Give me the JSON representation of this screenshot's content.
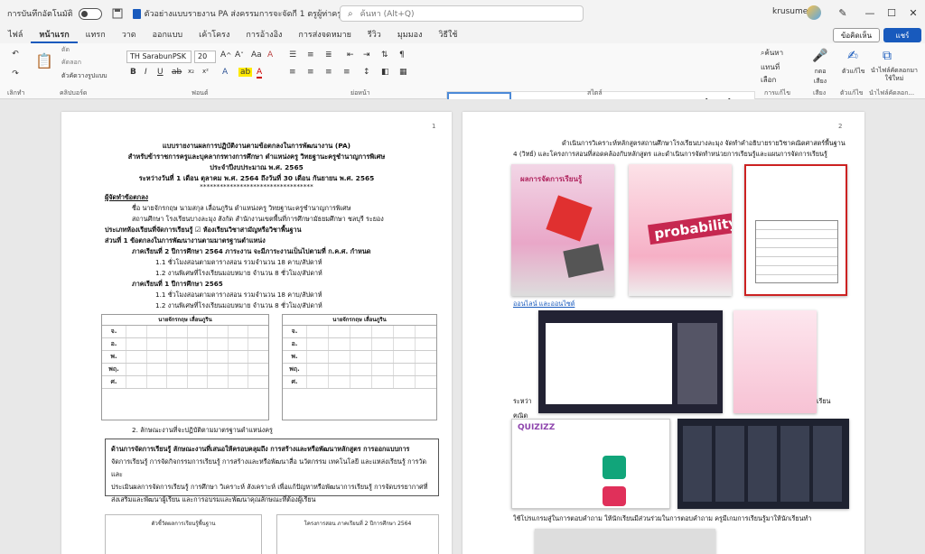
{
  "titlebar": {
    "autosave_label": "การบันทึกอัตโนมัติ",
    "doc_title": "ตัวอย่างแบบรายงาน PA ส่งครรมการจะจัดกี 1 ตรูผู้ท่าครูส.docx",
    "search_placeholder": "ค้นหา (Alt+Q)",
    "user": "krusumet2"
  },
  "menu": {
    "tabs": [
      "ไฟล์",
      "หน้าแรก",
      "แทรก",
      "วาด",
      "ออกแบบ",
      "เค้าโครง",
      "การอ้างอิง",
      "การส่งจดหมาย",
      "รีวิว",
      "มุมมอง",
      "วิธีใช้"
    ],
    "active": "หน้าแรก",
    "comments": "ข้อคิดเห็น",
    "share": "แชร์"
  },
  "ribbon": {
    "font_name": "TH SarabunPSK",
    "font_size": "20",
    "groups": [
      "เลิกทำ",
      "คลิปบอร์ด",
      "ฟอนต์",
      "ย่อหน้า",
      "สไตล์",
      "การแก้ไข",
      "เสียง",
      "ตัวแก้ไข",
      "นำไฟล์คัดลอก..."
    ],
    "clipboard": [
      "ตัด",
      "คัดลอก",
      "ตัวคัดวางรูปแบบ"
    ],
    "styles": [
      "ปกติ",
      "ไม่มีการเว้นระยะ",
      "หัวเรื่อง 1",
      "หัวเรื่อง 2",
      "ชื่อเรื่อง"
    ],
    "editing": [
      "ค้นหา",
      "แทนที่",
      "เลือก"
    ],
    "voice": "กดอ เสียง",
    "editor": "ตัวแก้ไข",
    "reuse": "นำไฟล์คัดลอกมาใช้ใหม่"
  },
  "page1": {
    "number": "1",
    "heading": [
      "แบบรายงานผลการปฏิบัติงานตามข้อตกลงในการพัฒนางาน (PA)",
      "สำหรับข้าราชการครูและบุคลากรทางการศึกษา ตำแหน่งครู วิทยฐานะครูชำนาญการพิเศษ",
      "ประจำปีงบประมาณ พ.ศ. 2565",
      "ระหว่างวันที่ 1 เดือน ตุลาคม พ.ศ. 2564 ถึงวันที่ 30 เดือน กันยายน พ.ศ. 2565",
      "**********************************"
    ],
    "lines": [
      "ผู้จัดทำข้อตกลง",
      "ชื่อ นายจักรกฤษ  นามสกุล  เลื่อนภูริน  ตำแหน่งครู วิทยฐานะครูชำนาญการพิเศษ",
      "สถานศึกษา  โรงเรียนบางละมุง  สังกัด สำนักงานเขตพื้นที่การศึกษามัธยมศึกษา ชลบุรี ระยอง",
      "ประเภทห้องเรียนที่จัดการเรียนรู้  ☑ ห้องเรียนวิชาสามัญหรือวิชาพื้นฐาน",
      "ส่วนที่ 1 ข้อตกลงในการพัฒนางานตามมาตรฐานตำแหน่ง",
      "ภาคเรียนที่ 2 ปีการศึกษา 2564  ภาระงาน จะมีภาระงานเป็นไปตามที่ ก.ค.ศ. กำหนด",
      "1.1 ชั่วโมงสอนตามตารางสอน รวมจำนวน  18  คาบ/สัปดาห์",
      "1.2 งานพิเศษที่โรงเรียนมอบหมาย จำนวน 8 ชั่วโมง/สัปดาห์",
      "ภาคเรียนที่ 1 ปีการศึกษา 2565",
      "1.1 ชั่วโมงสอนตามตารางสอน รวมจำนวน  18  คาบ/สัปดาห์",
      "1.2 งานพิเศษที่โรงเรียนมอบหมาย จำนวน 8 ชั่วโมง/สัปดาห์",
      "2. ลักษณะงานที่จะปฏิบัติตามมาตรฐานตำแหน่งครู"
    ],
    "schedule_left": {
      "title": "นายจักรกฤษ  เลื่อนภูริน",
      "days": [
        "จ.",
        "อ.",
        "พ.",
        "พฤ.",
        "ศ."
      ]
    },
    "schedule_right": {
      "title": "นายจักรกฤษ  เลื่อนภูริน",
      "days": [
        "จ.",
        "อ.",
        "พ.",
        "พฤ.",
        "ศ."
      ]
    },
    "box_lines": [
      "ด้านการจัดการเรียนรู้  ลักษณะงานที่เสนอให้ครอบคลุมถึง การสร้างและหรือพัฒนาหลักสูตร การออกแบบการ",
      "จัดการเรียนรู้ การจัดกิจกรรมการเรียนรู้ การสร้างและหรือพัฒนาสื่อ นวัตกรรม เทคโนโลยี และแหล่งเรียนรู้ การวัดและ",
      "ประเมินผลการจัดการเรียนรู้ การศึกษา วิเคราะห์ สังเคราะห์ เพื่อแก้ปัญหาหรือพัฒนาการเรียนรู้ การจัดบรรยากาศที่",
      "ส่งเสริมและพัฒนาผู้เรียน และการอบรมและพัฒนาคุณลักษณะที่ต้องผู้เรียน"
    ],
    "bottom_left": "ตัวชี้วัดผลการเรียนรู้พื้นฐาน",
    "bottom_right": "โครงการสอน ภาคเรียนที่ 2 ปีการศึกษา 2564"
  },
  "page2": {
    "number": "2",
    "top_lines": [
      "ดำเนินการวิเคราะห์หลักสูตรสถานศึกษาโรงเรียนบางละมุง จัดทำคำอธิบายรายวิชาคณิตศาสตร์พื้นฐาน",
      "4 (วิทย์) และโครงการสอนที่สอดคล้องกับหลักสูตร และดำเนินการจัดทำหน่วยการเรียนรู้และแผนการจัดการเรียนรู้"
    ],
    "img1_title": "ผลการจัดการเรียนรู้",
    "img2_title": "probability",
    "mid_caption": "ออนไลน์ และออนไซต์",
    "side_text1": "ระหว่า",
    "side_text2": "ฅณิต",
    "side_text3": "เรียน",
    "quizizz": "QUIZIZZ",
    "bottom_line": "ใช้โปรแกรมสู่ในการตอบคำถาม  ให้นักเรียนมีส่วนร่วมในการตอบคำถาม ครูมีเกมการเรียนรู้มาให้นักเรียนทำ"
  },
  "colors": {
    "accent": "#185abd",
    "ribbon_bg": "#f9f9f9",
    "canvas_bg": "#e8e8e8"
  }
}
